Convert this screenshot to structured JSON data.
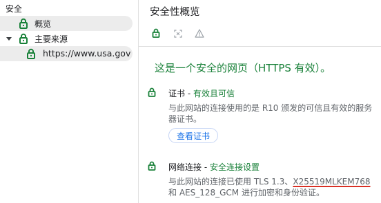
{
  "tree": {
    "root_label": "安全",
    "overview_label": "概览",
    "main_sources_label": "主要来源",
    "origin_label": "https://www.usa.gov"
  },
  "panel": {
    "title": "安全性概览",
    "summary": "这是一个安全的网页（HTTPS 有效）。",
    "certificate": {
      "heading_prefix": "证书 - ",
      "heading_status": "有效且可信",
      "description": "与此网站的连接使用的是 R10 颁发的可信且有效的服务器证书。",
      "button_label": "查看证书"
    },
    "connection": {
      "heading_prefix": "网络连接 - ",
      "heading_status": "安全连接设置",
      "desc_before": "与此网站的连接已使用 TLS 1.3、",
      "desc_key_exchange": "X25519MLKEM768",
      "desc_after": " 和 AES_128_GCM 进行加密和身份验证。"
    }
  },
  "colors": {
    "secure_green": "#188038",
    "link_blue": "#1a73e8",
    "warning_underline": "#d93025",
    "selected_row_bg": "#ececec"
  },
  "icons": [
    "lock-icon",
    "certificate-scan-icon",
    "warning-triangle-icon",
    "caret-down-icon"
  ]
}
